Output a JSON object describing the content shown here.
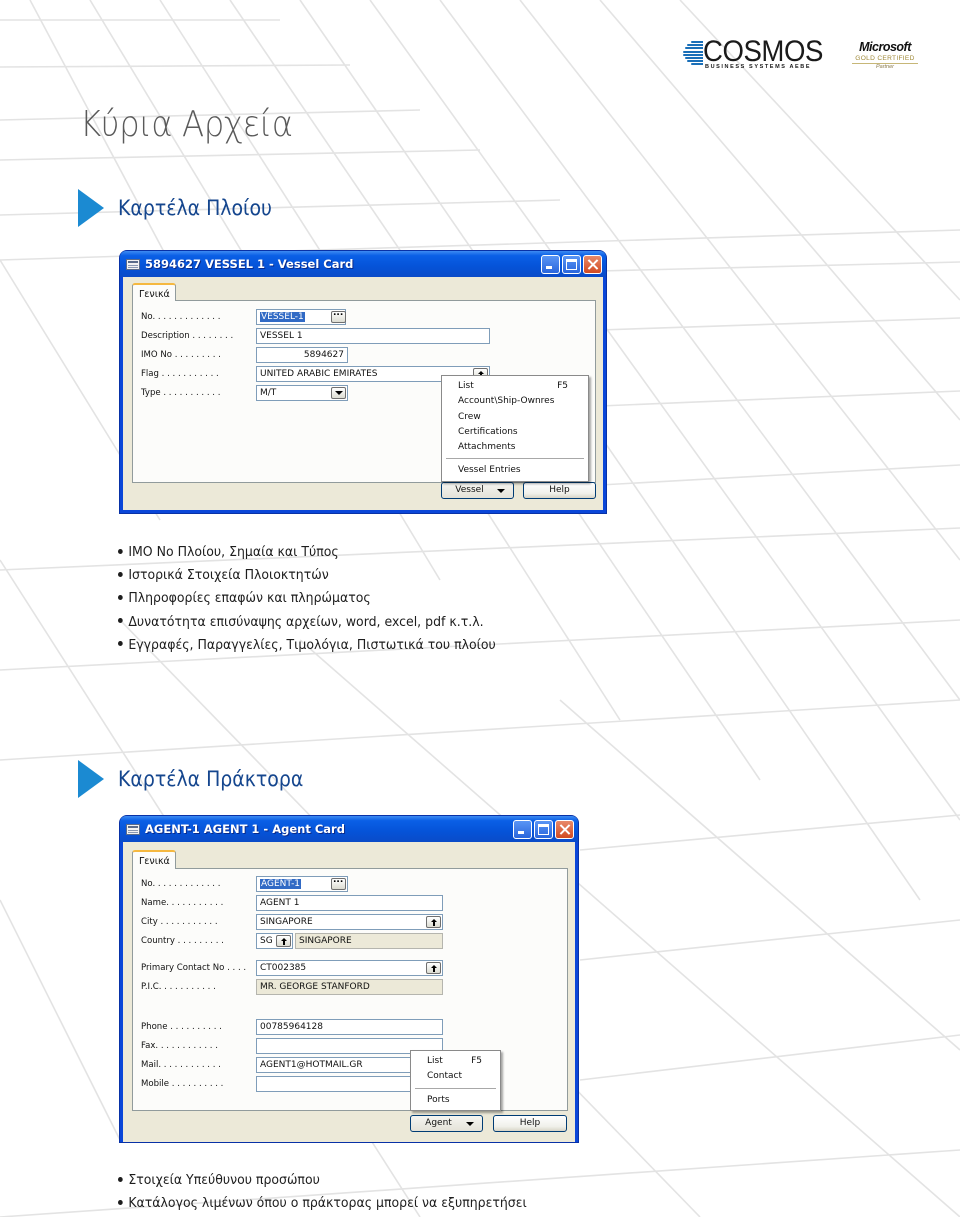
{
  "header": {
    "brand": {
      "name": "COSMOS",
      "tagline": "BUSINESS SYSTEMS AEBE"
    },
    "partner": {
      "name": "Microsoft",
      "level": "GOLD CERTIFIED",
      "label": "Partner"
    },
    "page_title": "Κύρια Αρχεία"
  },
  "colors": {
    "section_arrow": "#1b8ad2",
    "section_title": "#15468e",
    "page_title": "#5a5a5a",
    "xp_titlebar": "#0553d8",
    "xp_body": "#ece9d8",
    "selection": "#316ac5"
  },
  "vessel_section": {
    "title": "Καρτέλα Πλοίου",
    "window": {
      "title": "5894627 VESSEL 1 - Vessel Card",
      "icon": "table-icon",
      "controls": [
        "minimize",
        "maximize",
        "close"
      ],
      "tab": "Γενικά",
      "fields": [
        {
          "label": "No. . . . . . . . . . . . .",
          "value": "VESSEL-1",
          "button": "lookup-dots"
        },
        {
          "label": "Description . . . . . . . .",
          "value": "VESSEL 1"
        },
        {
          "label": "IMO No . . . . . . . . .",
          "value": "5894627"
        },
        {
          "label": "Flag . . . . . . . . . . .",
          "value": "UNITED ARABIC EMIRATES",
          "button": "lookup-up"
        },
        {
          "label": "Type . . . . . . . . . . .",
          "value": "M/T",
          "button": "dropdown"
        }
      ],
      "menu": {
        "items": [
          {
            "label": "List",
            "shortcut": "F5"
          },
          {
            "label": "Account\\Ship-Ownres"
          },
          {
            "label": "Crew"
          },
          {
            "label": "Certifications"
          },
          {
            "label": "Attachments"
          }
        ],
        "after_separator": [
          {
            "label": "Vessel Entries"
          }
        ]
      },
      "buttons": {
        "menu": "Vessel",
        "help": "Help"
      }
    },
    "bullets": [
      "IMO No Πλοίου, Σημαία και Τύπος",
      "Ιστορικά Στοιχεία Πλοιοκτητών",
      "Πληροφορίες επαφών και πληρώματος",
      "Δυνατότητα επισύναψης αρχείων, word, excel, pdf κ.τ.λ.",
      "Εγγραφές, Παραγγελίες, Τιμολόγια, Πιστωτικά του πλοίου"
    ]
  },
  "agent_section": {
    "title": "Καρτέλα Πράκτορα",
    "window": {
      "title": "AGENT-1 AGENT 1 - Agent Card",
      "icon": "table-icon",
      "controls": [
        "minimize",
        "maximize",
        "close"
      ],
      "tab": "Γενικά",
      "fields": [
        {
          "label": "No. . . . . . . . . . . . .",
          "value": "AGENT-1",
          "button": "lookup-dots"
        },
        {
          "label": "Name. . . . . . . . . . .",
          "value": "AGENT 1"
        },
        {
          "label": "City . . . . . . . . . . .",
          "value": "SINGAPORE",
          "button": "lookup-up"
        },
        {
          "label": "Country . . . . . . . . .",
          "code": "SG",
          "value": "SINGAPORE",
          "button": "lookup-up"
        },
        {
          "label": "Primary Contact No . . . .",
          "value": "CT002385",
          "button": "lookup-up"
        },
        {
          "label": "P.I.C. . . . . . . . . . .",
          "value": "MR. GEORGE STANFORD"
        },
        {
          "label": "Phone . . . . . . . . . .",
          "value": "00785964128"
        },
        {
          "label": "Fax. . . . . . . . . . . .",
          "value": ""
        },
        {
          "label": "Mail. . . . . . . . . . . .",
          "value": "AGENT1@HOTMAIL.GR"
        },
        {
          "label": "Mobile . . . . . . . . . .",
          "value": ""
        }
      ],
      "menu": {
        "items": [
          {
            "label": "List",
            "shortcut": "F5"
          },
          {
            "label": "Contact"
          }
        ],
        "after_separator": [
          {
            "label": "Ports"
          }
        ]
      },
      "buttons": {
        "menu": "Agent",
        "help": "Help"
      }
    },
    "bullets": [
      "Στοιχεία Υπεύθυνου προσώπου",
      "Κατάλογος λιμένων όπου ο πράκτορας μπορεί να εξυπηρετήσει"
    ]
  }
}
